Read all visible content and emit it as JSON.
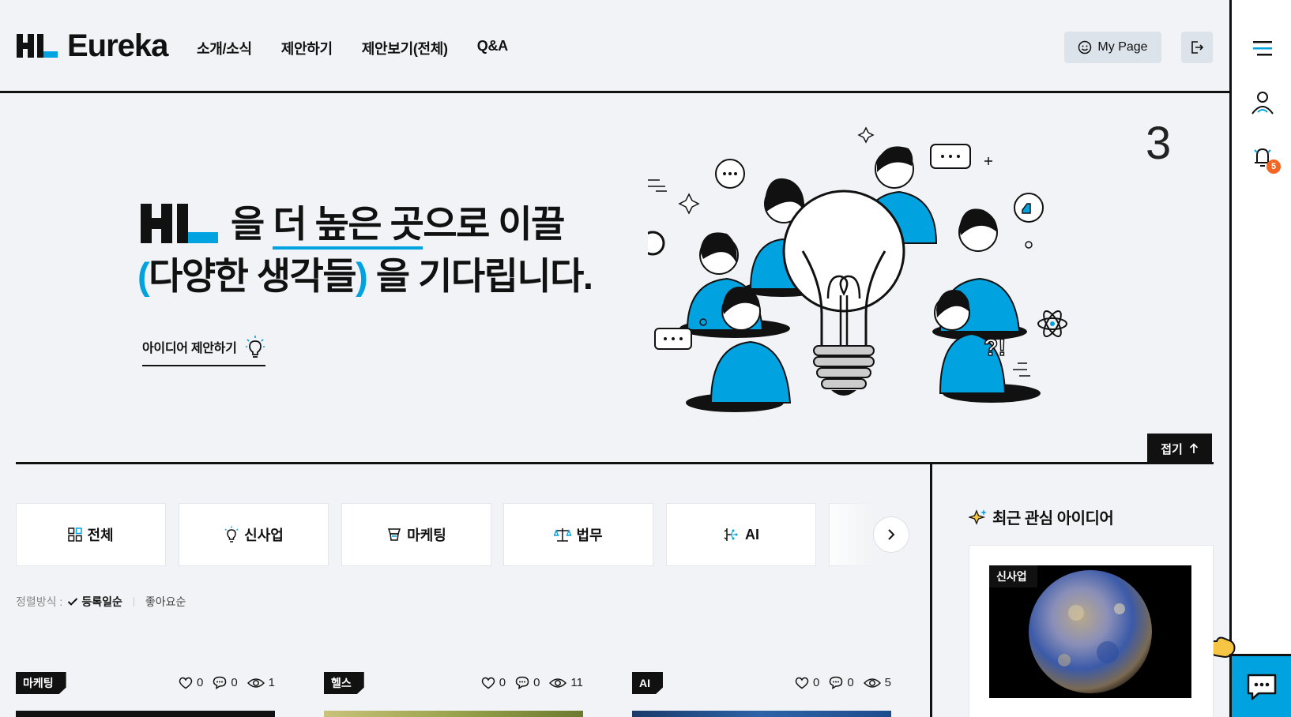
{
  "header": {
    "logo_text": "Eureka",
    "nav": [
      "소개/소식",
      "제안하기",
      "제안보기(전체)",
      "Q&A"
    ],
    "mypage_label": "My Page"
  },
  "rail": {
    "notification_count": "5"
  },
  "hero": {
    "line1_a": " 을 ",
    "line1_b": "더 높은 곳",
    "line1_c": "으로 이끌",
    "line2_open": "(",
    "line2_b": "다양한 생각들",
    "line2_close": ")",
    "line2_c": " 을 기다립니다.",
    "idea_link": "아이디어 제안하기",
    "slide_number": "3",
    "fold_label": "접기"
  },
  "categories": [
    {
      "label": "전체",
      "icon": "grid-icon"
    },
    {
      "label": "신사업",
      "icon": "lightbulb-icon"
    },
    {
      "label": "마케팅",
      "icon": "megaphone-icon"
    },
    {
      "label": "법무",
      "icon": "scale-icon"
    },
    {
      "label": "AI",
      "icon": "ai-icon"
    }
  ],
  "sort": {
    "label": "정렬방식 :",
    "active": "등록일순",
    "option": "좋아요순"
  },
  "cards": [
    {
      "tag": "마케팅",
      "likes": "0",
      "comments": "0",
      "views": "1"
    },
    {
      "tag": "헬스",
      "likes": "0",
      "comments": "0",
      "views": "11"
    },
    {
      "tag": "AI",
      "likes": "0",
      "comments": "0",
      "views": "5"
    }
  ],
  "recent": {
    "title": "최근 관심 아이디어",
    "card_tag": "신사업"
  },
  "colors": {
    "accent": "#00a3e0",
    "dark": "#111111",
    "background": "#f1f3f6",
    "badge": "#f26522"
  }
}
